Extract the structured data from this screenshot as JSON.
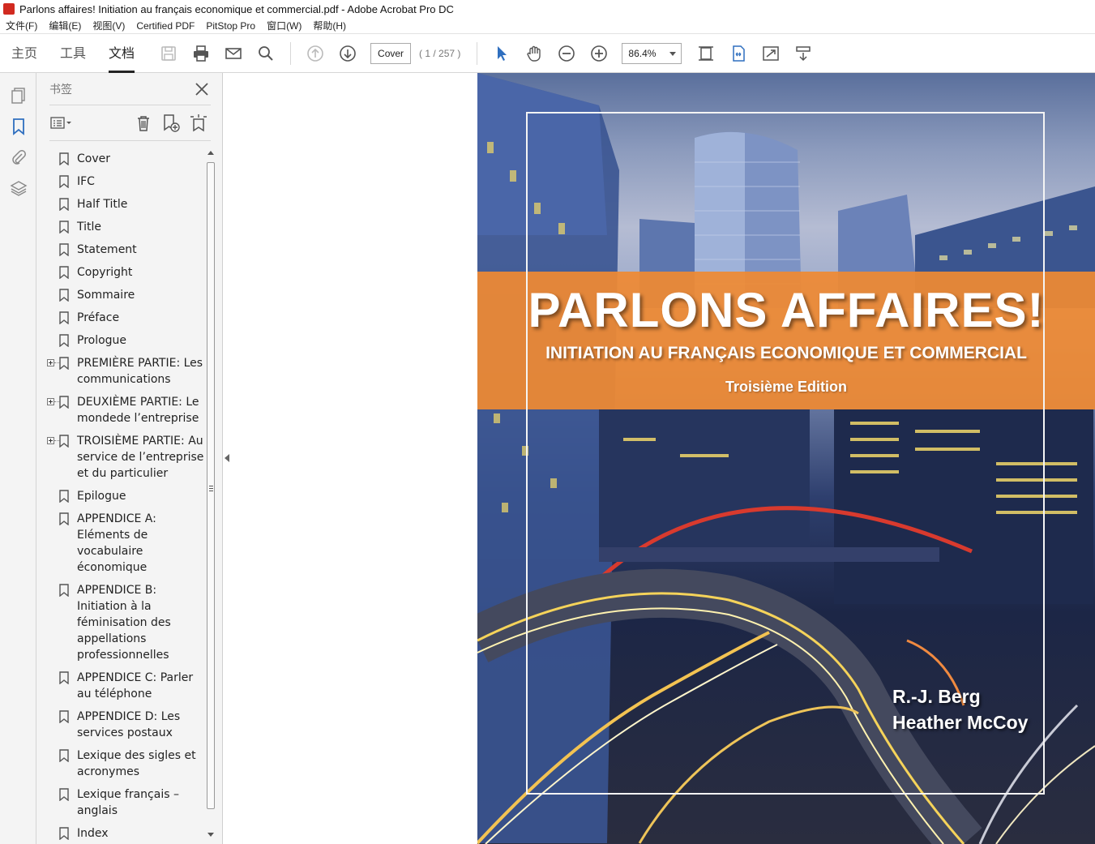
{
  "window": {
    "title": "Parlons affaires! Initiation au français economique et commercial.pdf - Adobe Acrobat Pro DC"
  },
  "menu": [
    "文件(F)",
    "编辑(E)",
    "视图(V)",
    "Certified PDF",
    "PitStop Pro",
    "窗口(W)",
    "帮助(H)"
  ],
  "toolbar": {
    "tabs": [
      "主页",
      "工具",
      "文档"
    ],
    "active_tab": "文档",
    "page_field": "Cover",
    "page_count": "( 1 / 257 )",
    "zoom": "86.4%"
  },
  "bookmarks_panel": {
    "title": "书签",
    "items": [
      {
        "label": "Cover",
        "expandable": false
      },
      {
        "label": "IFC",
        "expandable": false
      },
      {
        "label": "Half Title",
        "expandable": false
      },
      {
        "label": "Title",
        "expandable": false
      },
      {
        "label": "Statement",
        "expandable": false
      },
      {
        "label": "Copyright",
        "expandable": false
      },
      {
        "label": "Sommaire",
        "expandable": false
      },
      {
        "label": "Préface",
        "expandable": false
      },
      {
        "label": "Prologue",
        "expandable": false
      },
      {
        "label": "PREMIÈRE PARTIE: Les communications",
        "expandable": true
      },
      {
        "label": "DEUXIÈME PARTIE: Le mondede l’entreprise",
        "expandable": true
      },
      {
        "label": "TROISIÈME PARTIE:  Au service de l’entreprise et du particulier",
        "expandable": true
      },
      {
        "label": "Epilogue",
        "expandable": false
      },
      {
        "label": "APPENDICE A: Eléments de vocabulaire économique",
        "expandable": false
      },
      {
        "label": "APPENDICE B: Initiation à la féminisation des appellations professionnelles",
        "expandable": false
      },
      {
        "label": "APPENDICE C: Parler au téléphone",
        "expandable": false
      },
      {
        "label": "APPENDICE D: Les services postaux",
        "expandable": false
      },
      {
        "label": "Lexique des sigles et acronymes",
        "expandable": false
      },
      {
        "label": "Lexique français – anglais",
        "expandable": false
      },
      {
        "label": "Index",
        "expandable": false
      }
    ]
  },
  "cover": {
    "title": "PARLONS AFFAIRES!",
    "subtitle": "INITIATION AU FRANÇAIS ECONOMIQUE ET COMMERCIAL",
    "edition": "Troisième Edition",
    "authors": [
      "R.-J. Berg",
      "Heather McCoy"
    ],
    "band_color": "#ef8a33"
  }
}
